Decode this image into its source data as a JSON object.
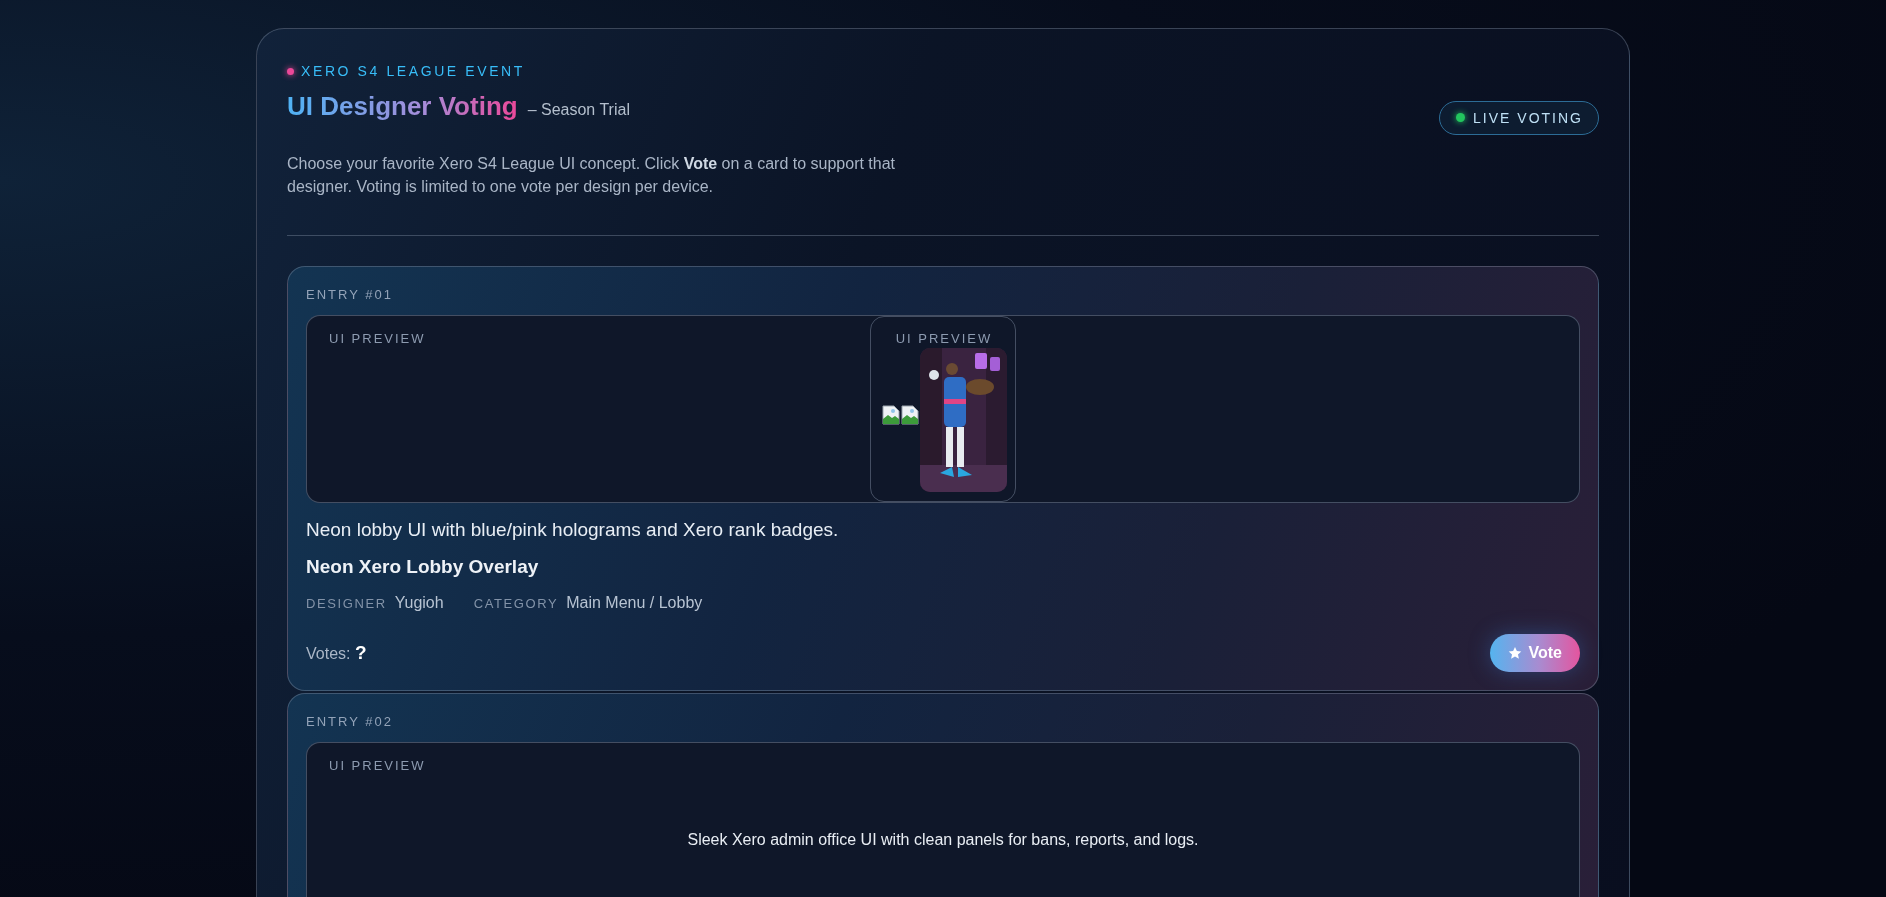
{
  "header": {
    "eyebrow": "XERO S4 LEAGUE EVENT",
    "title": "UI Designer Voting",
    "subtitle": "– Season Trial",
    "intro": "Choose your favorite Xero S4 League UI concept. Click **Vote** on a card to support that designer. Voting is limited to one vote per design per device.",
    "live_badge": {
      "label": "LIVE VOTING",
      "on": true
    }
  },
  "entries": [
    {
      "label": "ENTRY #01",
      "preview": {
        "kind": "gallery",
        "label": "UI PREVIEW",
        "inner_label": "UI PREVIEW"
      },
      "description": "Neon lobby UI with blue/pink holograms and Xero rank badges.",
      "title": "Neon Xero Lobby Overlay",
      "meta": [
        {
          "key": "DESIGNER",
          "value": "Yugioh"
        },
        {
          "key": "CATEGORY",
          "value": "Main Menu / Lobby"
        }
      ],
      "votes_label": "Votes:",
      "votes_value": "?",
      "vote_button": "Vote"
    },
    {
      "label": "ENTRY #02",
      "preview": {
        "kind": "caption",
        "label": "UI PREVIEW",
        "caption": "Sleek Xero admin office UI with clean panels for bans, reports, and logs."
      }
    }
  ]
}
